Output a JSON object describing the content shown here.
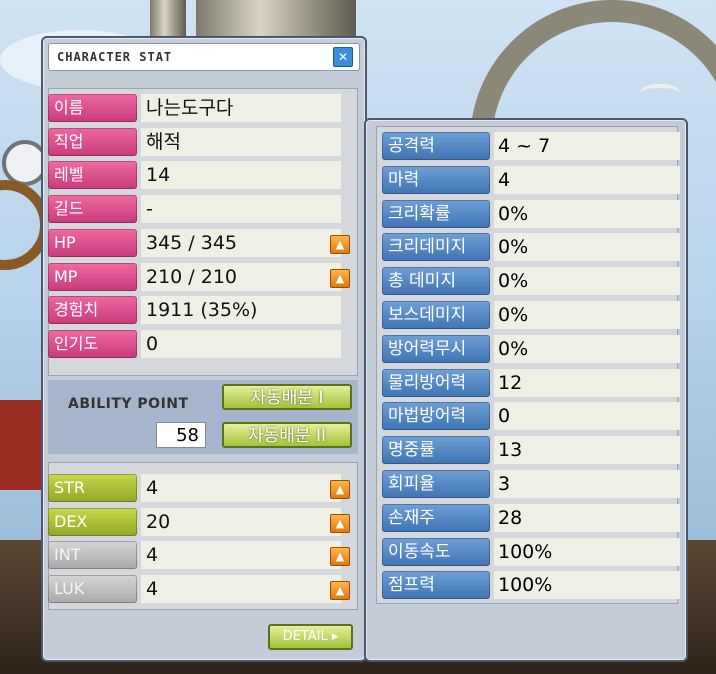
{
  "window": {
    "title": "CHARACTER STAT",
    "close_glyph": "✕"
  },
  "profile": [
    {
      "label": "이름",
      "value": "나는도구다",
      "color": "pink"
    },
    {
      "label": "직업",
      "value": "해적",
      "color": "pink"
    },
    {
      "label": "레벨",
      "value": "14",
      "color": "pink"
    },
    {
      "label": "길드",
      "value": "-",
      "color": "pink"
    },
    {
      "label": "HP",
      "value": "345 / 345",
      "color": "pink",
      "up": true
    },
    {
      "label": "MP",
      "value": "210 / 210",
      "color": "pink",
      "up": true
    },
    {
      "label": "경험치",
      "value": "1911 (35%)",
      "color": "pink"
    },
    {
      "label": "인기도",
      "value": "0",
      "color": "pink"
    }
  ],
  "ability": {
    "label": "ABILITY POINT",
    "value": "58",
    "auto1": "자동배분 I",
    "auto2": "자동배분 II"
  },
  "stats": [
    {
      "label": "STR",
      "value": "4",
      "color": "green"
    },
    {
      "label": "DEX",
      "value": "20",
      "color": "green"
    },
    {
      "label": "INT",
      "value": "4",
      "color": "gray"
    },
    {
      "label": "LUK",
      "value": "4",
      "color": "gray"
    }
  ],
  "detail_button": "DETAIL ▸",
  "detail_stats": [
    {
      "label": "공격력",
      "value": "4 ~ 7"
    },
    {
      "label": "마력",
      "value": "4"
    },
    {
      "label": "크리확률",
      "value": "0%"
    },
    {
      "label": "크리데미지",
      "value": "0%"
    },
    {
      "label": "총 데미지",
      "value": "0%"
    },
    {
      "label": "보스데미지",
      "value": "0%"
    },
    {
      "label": "방어력무시",
      "value": "0%"
    },
    {
      "label": "물리방어력",
      "value": "12"
    },
    {
      "label": "마법방어력",
      "value": "0"
    },
    {
      "label": "명중률",
      "value": "13"
    },
    {
      "label": "회피율",
      "value": "3"
    },
    {
      "label": "손재주",
      "value": "28"
    },
    {
      "label": "이동속도",
      "value": "100%"
    },
    {
      "label": "점프력",
      "value": "100%"
    }
  ],
  "up_glyph": "▲"
}
